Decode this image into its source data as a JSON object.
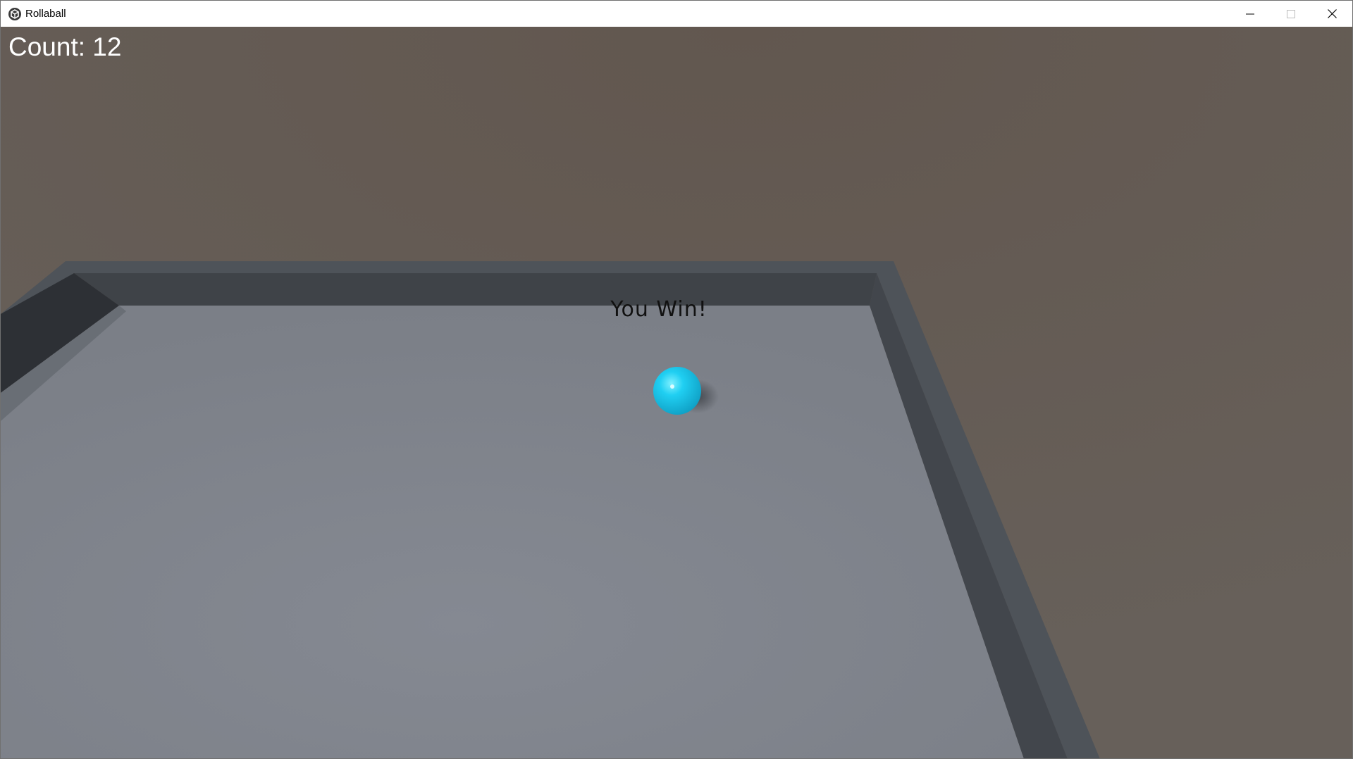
{
  "window": {
    "title": "Rollaball",
    "app_icon": "unity-logo-icon",
    "controls": {
      "minimize": "minimize-icon",
      "maximize": "maximize-icon",
      "close": "close-icon"
    }
  },
  "hud": {
    "count_text": "Count: 12",
    "win_text": "You Win!"
  },
  "colors": {
    "sky": "#665f5a",
    "ground": "#7f838b",
    "wall_top": "#4e5359",
    "wall_inner": "#40444a",
    "ball": "#1ec8ee",
    "count_text": "#ffffff",
    "win_text": "#111111"
  }
}
